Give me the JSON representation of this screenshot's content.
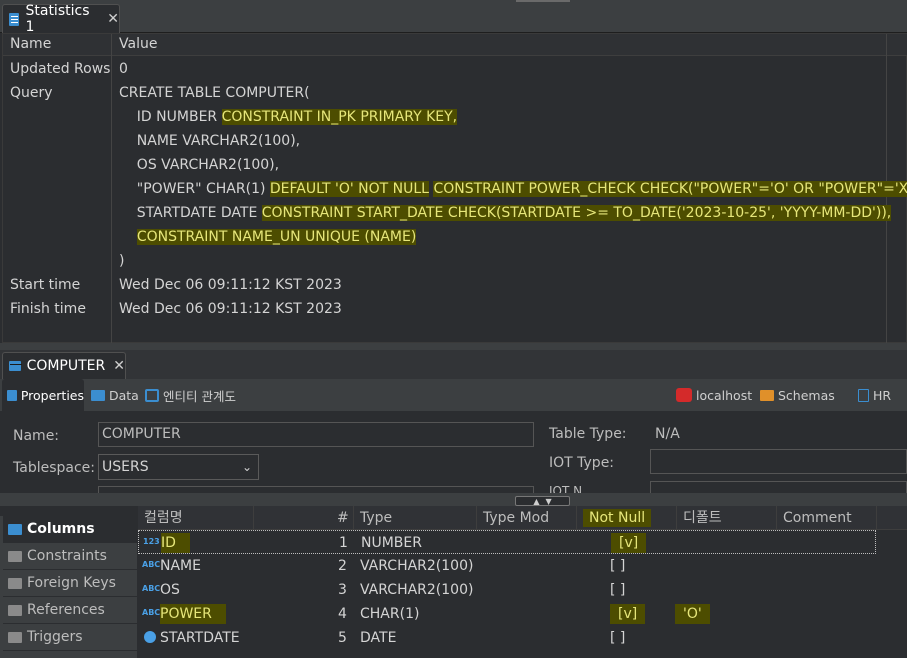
{
  "top_tab": {
    "title": "Statistics 1"
  },
  "stats": {
    "headers": {
      "name": "Name",
      "value": "Value"
    },
    "updated_rows": {
      "name": "Updated Rows",
      "value": "0"
    },
    "query": {
      "name": "Query",
      "lines": [
        [
          "CREATE TABLE COMPUTER("
        ],
        [
          "    ID NUMBER ",
          "CONSTRAINT IN_PK PRIMARY KEY,"
        ],
        [
          "    NAME VARCHAR2(100),"
        ],
        [
          "    OS VARCHAR2(100),"
        ],
        [
          "    \"POWER\" CHAR(1) ",
          "DEFAULT 'O' NOT NULL",
          " ",
          "CONSTRAINT POWER_CHECK CHECK(\"POWER\"='O' OR \"POWER\"='X'),"
        ],
        [
          "    STARTDATE DATE ",
          "CONSTRAINT START_DATE CHECK(STARTDATE >= TO_DATE('2023-10-25', 'YYYY-MM-DD')),"
        ],
        [
          "    ",
          "CONSTRAINT NAME_UN UNIQUE (NAME)"
        ],
        [
          ")"
        ]
      ]
    },
    "start_time": {
      "name": "Start time",
      "value": "Wed Dec 06 09:11:12 KST 2023"
    },
    "finish_time": {
      "name": "Finish time",
      "value": "Wed Dec 06 09:11:12 KST 2023"
    }
  },
  "editor_tab": {
    "title": "COMPUTER"
  },
  "subtabs": {
    "properties": "Properties",
    "data": "Data",
    "er": "엔티티 관계도",
    "connection": "localhost",
    "schemas": "Schemas",
    "user": "HR"
  },
  "properties": {
    "name_label": "Name:",
    "name_value": "COMPUTER",
    "tablespace_label": "Tablespace:",
    "tablespace_value": "USERS",
    "table_type_label": "Table Type:",
    "table_type_value": "N/A",
    "iot_type_label": "IOT Type:",
    "iot_partial_label": "IOT N"
  },
  "leftnav": {
    "items": [
      "Columns",
      "Constraints",
      "Foreign Keys",
      "References",
      "Triggers"
    ]
  },
  "grid": {
    "headers": {
      "name": "컬럼명",
      "num": "#",
      "type": "Type",
      "type_mod": "Type Mod",
      "not_null": "Not Null",
      "default": "디폴트",
      "comment": "Comment"
    },
    "rows": [
      {
        "type_icon": "123",
        "name": "ID",
        "num": "1",
        "type": "NUMBER",
        "not_null": "[v]",
        "default": ""
      },
      {
        "type_icon": "ABC",
        "name": "NAME",
        "num": "2",
        "type": "VARCHAR2(100)",
        "not_null": "[ ]",
        "default": ""
      },
      {
        "type_icon": "ABC",
        "name": "OS",
        "num": "3",
        "type": "VARCHAR2(100)",
        "not_null": "[ ]",
        "default": ""
      },
      {
        "type_icon": "ABC",
        "name": "POWER",
        "num": "4",
        "type": "CHAR(1)",
        "not_null": "[v]",
        "default": "'O'"
      },
      {
        "type_icon": "clock",
        "name": "STARTDATE",
        "num": "5",
        "type": "DATE",
        "not_null": "[ ]",
        "default": ""
      }
    ]
  },
  "colors": {
    "highlight_bg": "#4d4d00",
    "highlight_fg": "#e6e67a",
    "accent_blue": "#3b8ed0"
  }
}
